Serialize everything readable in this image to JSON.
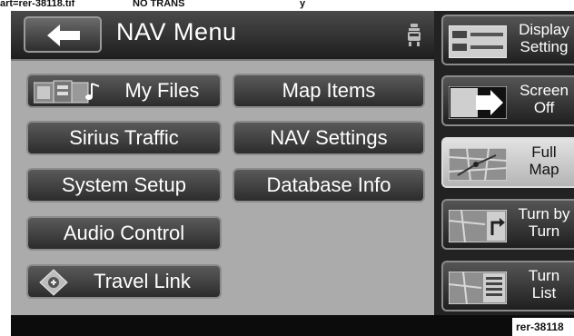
{
  "caption": {
    "art": "art=rer-38118.tif",
    "trans": "NO TRANS",
    "extra": "y"
  },
  "header": {
    "title": "NAV Menu"
  },
  "menu": {
    "my_files": "My Files",
    "map_items": "Map Items",
    "sirius_traffic": "Sirius Traffic",
    "nav_settings": "NAV Settings",
    "system_setup": "System Setup",
    "database_info": "Database Info",
    "audio_control": "Audio Control",
    "travel_link": "Travel Link"
  },
  "sidebar": {
    "display_settings": "Display\nSetting",
    "screen_off": "Screen\nOff",
    "full_map": "Full\nMap",
    "turn_by_turn": "Turn by\nTurn",
    "turn_list": "Turn\nList"
  },
  "footer": {
    "code": "rer-38118"
  },
  "icons": [
    "back-arrow-icon",
    "car-icon",
    "my-files-icon",
    "travel-link-icon",
    "display-settings-icon",
    "screen-off-icon",
    "full-map-icon",
    "turn-by-turn-icon",
    "turn-list-icon"
  ],
  "colors": {
    "menu_panel": "#ababab",
    "button": "#3c3c3c",
    "active_sidebar": "#d0d0d0"
  }
}
